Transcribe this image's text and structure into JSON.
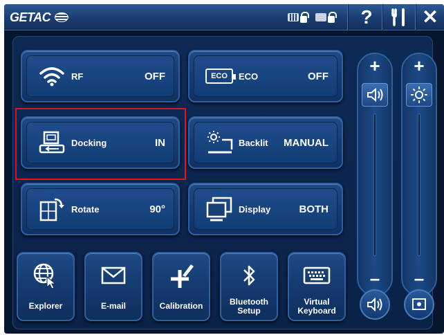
{
  "header": {
    "logo_text": "GETAC",
    "help_label": "?",
    "close_label": "✕"
  },
  "tiles": {
    "rf": {
      "label": "RF",
      "value": "OFF"
    },
    "eco": {
      "label": "ECO",
      "value": "OFF",
      "icon_text": "ECO"
    },
    "docking": {
      "label": "Docking",
      "value": "IN"
    },
    "backlit": {
      "label": "Backlit",
      "value": "MANUAL"
    },
    "rotate": {
      "label": "Rotate",
      "value": "90°"
    },
    "display": {
      "label": "Display",
      "value": "BOTH"
    }
  },
  "apps": {
    "explorer": "Explorer",
    "email": "E-mail",
    "calibration": "Calibration",
    "bluetooth": "Bluetooth\nSetup",
    "keyboard": "Virtual\nKeyboard"
  },
  "sliders": {
    "plus": "+",
    "minus": "–"
  },
  "colors": {
    "background": "#07162e",
    "tile": "#1b467f",
    "highlight": "#e0161c",
    "text": "#ffffff"
  }
}
